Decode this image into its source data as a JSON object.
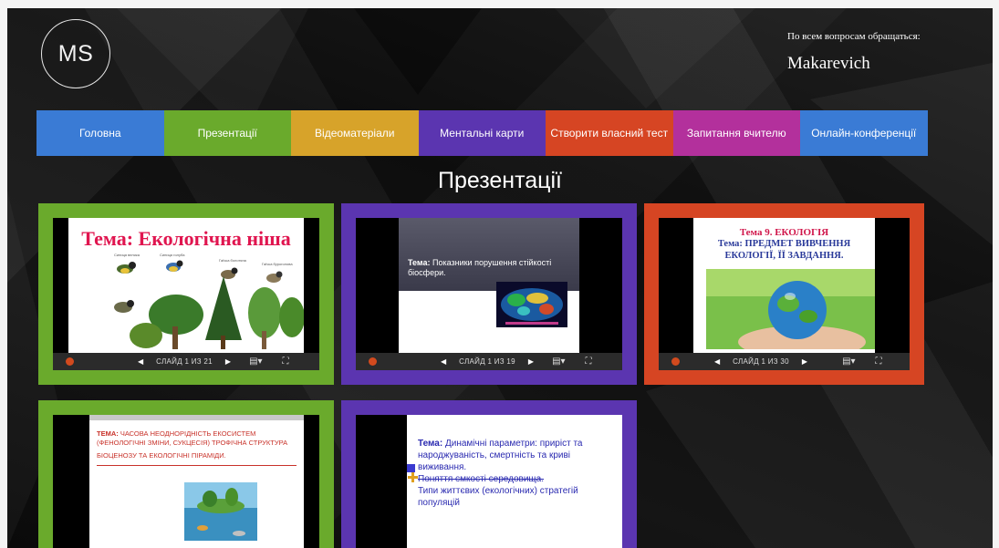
{
  "header": {
    "logo_text": "MS",
    "contact_label": "По всем вопросам обращаться:",
    "contact_name": "Makarevich"
  },
  "nav": [
    {
      "label": "Головна",
      "color": "#3a7bd5"
    },
    {
      "label": "Презентації",
      "color": "#6aaa2c"
    },
    {
      "label": "Відеоматеріали",
      "color": "#d7a32a"
    },
    {
      "label": "Ментальні карти",
      "color": "#5b35b0"
    },
    {
      "label": "Створити власний тест",
      "color": "#d64523"
    },
    {
      "label": "Запитання вчителю",
      "color": "#b3309c"
    },
    {
      "label": "Онлайн-конференції",
      "color": "#3a7bd5"
    }
  ],
  "page_title": "Презентації",
  "cards": [
    {
      "frame_color": "#6aaa2c",
      "slide_title": "Тема: Екологічна ніша",
      "labels": [
        "Синиця велика",
        "Синиця голуба",
        "Гаїчка болотяна",
        "Гаїчка буроголова"
      ],
      "counter": "СЛАЙД 1 ИЗ 21"
    },
    {
      "frame_color": "#5b35b0",
      "slide_topic_label": "Тема:",
      "slide_topic": " Показники порушення стійкості біосфери.",
      "counter": "СЛАЙД 1 ИЗ 19"
    },
    {
      "frame_color": "#d64523",
      "slide_line1": "Тема 9. ЕКОЛОГІЯ",
      "slide_line2": "Тема: ПРЕДМЕТ ВИВЧЕННЯ ЕКОЛОГІЇ, ЇЇ ЗАВДАННЯ.",
      "counter": "СЛАЙД 1 ИЗ 30"
    },
    {
      "frame_color": "#6aaa2c",
      "slide_topic_label": "ТЕМА:",
      "slide_topic": " ЧАСОВА НЕОДНОРІДНІСТЬ ЕКОСИСТЕМ (ФЕНОЛОГІЧНІ ЗМІНИ, СУКЦЕСІЯ) ТРОФІЧНА СТРУКТУРА",
      "slide_sub": "БІОЦЕНОЗУ ТА ЕКОЛОГІЧНІ ПІРАМІДИ."
    },
    {
      "frame_color": "#5b35b0",
      "slide_topic_label": "Тема:",
      "slide_topic": " Динамічні параметри: приріст та народжуваність, смертність та криві виживання.",
      "slide_strike": "Поняття ємкості середовища.",
      "slide_rest": "Типи життєвих (екологічних) стратегій популяцій"
    }
  ],
  "icons": {
    "ppt": "powerpoint-icon",
    "prev": "◀",
    "next": "▶",
    "notes": "▤▾",
    "fullscreen": "⛶"
  }
}
